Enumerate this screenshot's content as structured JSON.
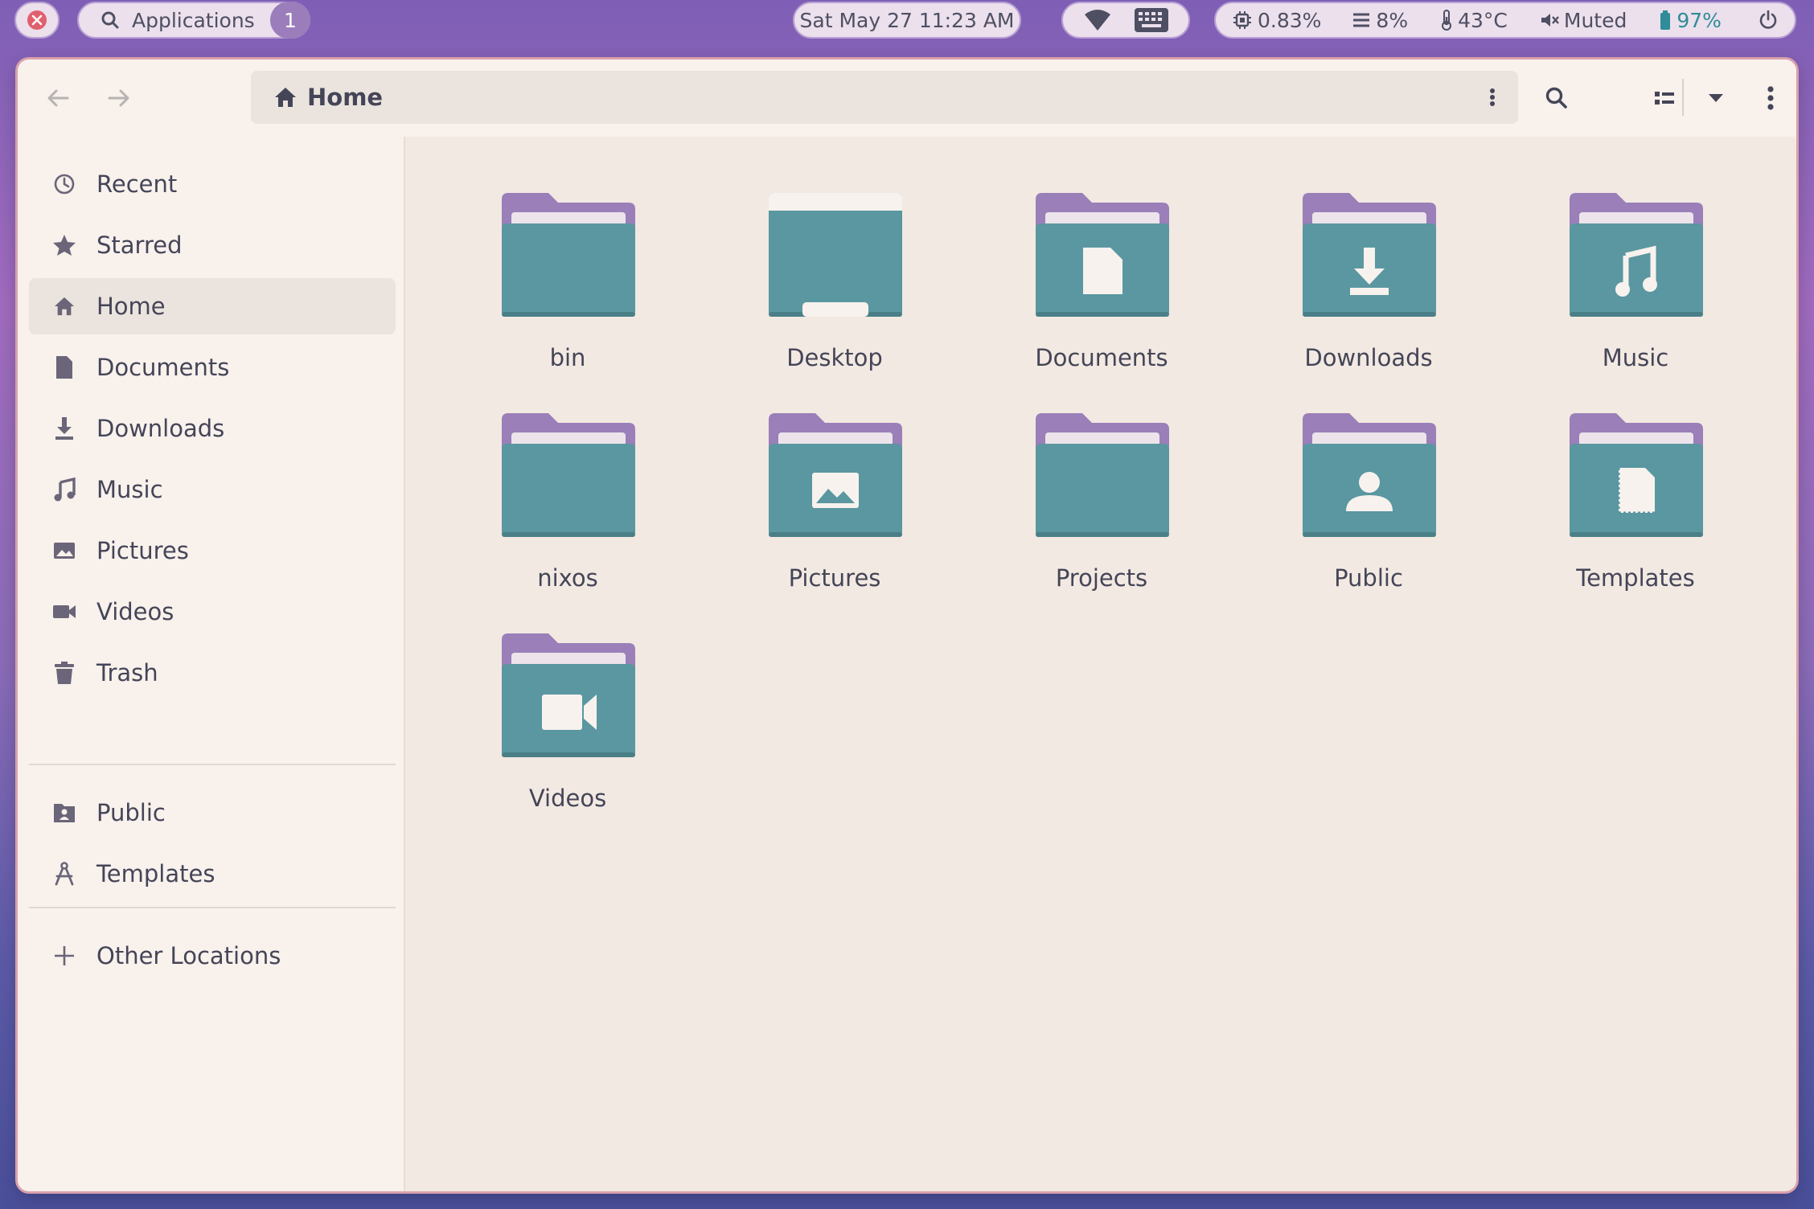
{
  "topbar": {
    "apps_label": "Applications",
    "workspace_number": "1",
    "clock": "Sat May 27 11:23 AM",
    "cpu": "0.83%",
    "memory": "8%",
    "temperature": "43°C",
    "volume": "Muted",
    "battery": "97%"
  },
  "headerbar": {
    "location": "Home"
  },
  "sidebar": {
    "items": [
      {
        "label": "Recent",
        "icon": "clock-icon"
      },
      {
        "label": "Starred",
        "icon": "star-icon"
      },
      {
        "label": "Home",
        "icon": "home-icon",
        "active": true
      },
      {
        "label": "Documents",
        "icon": "document-icon"
      },
      {
        "label": "Downloads",
        "icon": "download-icon"
      },
      {
        "label": "Music",
        "icon": "music-icon"
      },
      {
        "label": "Pictures",
        "icon": "image-icon"
      },
      {
        "label": "Videos",
        "icon": "video-camera-icon"
      },
      {
        "label": "Trash",
        "icon": "trash-icon"
      }
    ],
    "bookmarks": [
      {
        "label": "Public",
        "icon": "public-folder-icon"
      },
      {
        "label": "Templates",
        "icon": "templates-icon"
      }
    ],
    "other": {
      "label": "Other Locations",
      "icon": "plus-icon"
    }
  },
  "files": [
    {
      "name": "bin",
      "emblem": "none"
    },
    {
      "name": "Desktop",
      "emblem": "desktop"
    },
    {
      "name": "Documents",
      "emblem": "document"
    },
    {
      "name": "Downloads",
      "emblem": "download"
    },
    {
      "name": "Music",
      "emblem": "music"
    },
    {
      "name": "nixos",
      "emblem": "none"
    },
    {
      "name": "Pictures",
      "emblem": "picture"
    },
    {
      "name": "Projects",
      "emblem": "none"
    },
    {
      "name": "Public",
      "emblem": "person"
    },
    {
      "name": "Templates",
      "emblem": "template"
    },
    {
      "name": "Videos",
      "emblem": "video"
    }
  ],
  "colors": {
    "folder_body": "#5a97a0",
    "folder_tab": "#9a7fb9",
    "text": "#454558",
    "window_bg": "#f2e9e2"
  }
}
